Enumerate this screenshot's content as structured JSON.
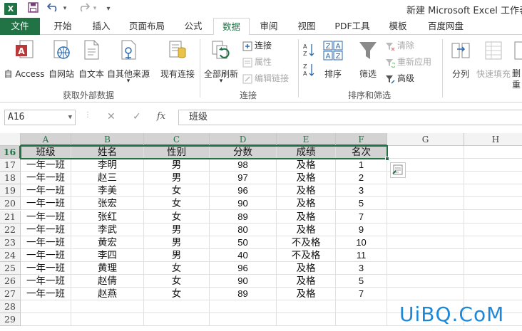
{
  "titlebar": {
    "app_logo": "X",
    "title": "新建 Microsoft Excel 工作表.x",
    "save_icon": "save-icon",
    "undo_icon": "undo-icon",
    "redo_icon": "redo-icon"
  },
  "tabs": [
    {
      "label": "文件"
    },
    {
      "label": "开始"
    },
    {
      "label": "插入"
    },
    {
      "label": "页面布局"
    },
    {
      "label": "公式"
    },
    {
      "label": "数据"
    },
    {
      "label": "审阅"
    },
    {
      "label": "视图"
    },
    {
      "label": "PDF工具"
    },
    {
      "label": "模板"
    },
    {
      "label": "百度网盘"
    }
  ],
  "ribbon": {
    "get_external": {
      "label": "获取外部数据",
      "buttons": [
        "自 Access",
        "自网站",
        "自文本",
        "自其他来源",
        "现有连接"
      ]
    },
    "connections": {
      "label": "连接",
      "refresh_all": "全部刷新",
      "items": [
        "连接",
        "属性",
        "编辑链接"
      ]
    },
    "sort_filter": {
      "label": "排序和筛选",
      "sort": "排序",
      "filter": "筛选",
      "items": [
        "清除",
        "重新应用",
        "高级"
      ]
    },
    "tools": {
      "split": "分列",
      "flash_fill": "快速填充",
      "partial": "删\n重"
    }
  },
  "formula_bar": {
    "name_box": "A16",
    "cancel": "✕",
    "enter": "✓",
    "fx": "fx",
    "value": "班级"
  },
  "columns": [
    "A",
    "B",
    "C",
    "D",
    "E",
    "F",
    "G",
    "H"
  ],
  "rows": [
    "16",
    "17",
    "18",
    "19",
    "20",
    "21",
    "22",
    "23",
    "24",
    "25",
    "26",
    "27",
    "28",
    "29"
  ],
  "table": {
    "headers": [
      "班级",
      "姓名",
      "性别",
      "分数",
      "成绩",
      "名次"
    ],
    "rows": [
      [
        "一年一班",
        "李明",
        "男",
        "98",
        "及格",
        "1"
      ],
      [
        "一年一班",
        "赵三",
        "男",
        "97",
        "及格",
        "2"
      ],
      [
        "一年一班",
        "李美",
        "女",
        "96",
        "及格",
        "3"
      ],
      [
        "一年一班",
        "张宏",
        "女",
        "90",
        "及格",
        "5"
      ],
      [
        "一年一班",
        "张红",
        "女",
        "89",
        "及格",
        "7"
      ],
      [
        "一年一班",
        "李武",
        "男",
        "80",
        "及格",
        "9"
      ],
      [
        "一年一班",
        "黄宏",
        "男",
        "50",
        "不及格",
        "10"
      ],
      [
        "一年一班",
        "李四",
        "男",
        "40",
        "不及格",
        "11"
      ],
      [
        "一年一班",
        "黄理",
        "女",
        "96",
        "及格",
        "3"
      ],
      [
        "一年一班",
        "赵倩",
        "女",
        "90",
        "及格",
        "5"
      ],
      [
        "一年一班",
        "赵燕",
        "女",
        "89",
        "及格",
        "7"
      ]
    ]
  },
  "watermark": "UiBQ.CoM",
  "colors": {
    "accent": "#217346",
    "watermark": "#1e88d8"
  }
}
